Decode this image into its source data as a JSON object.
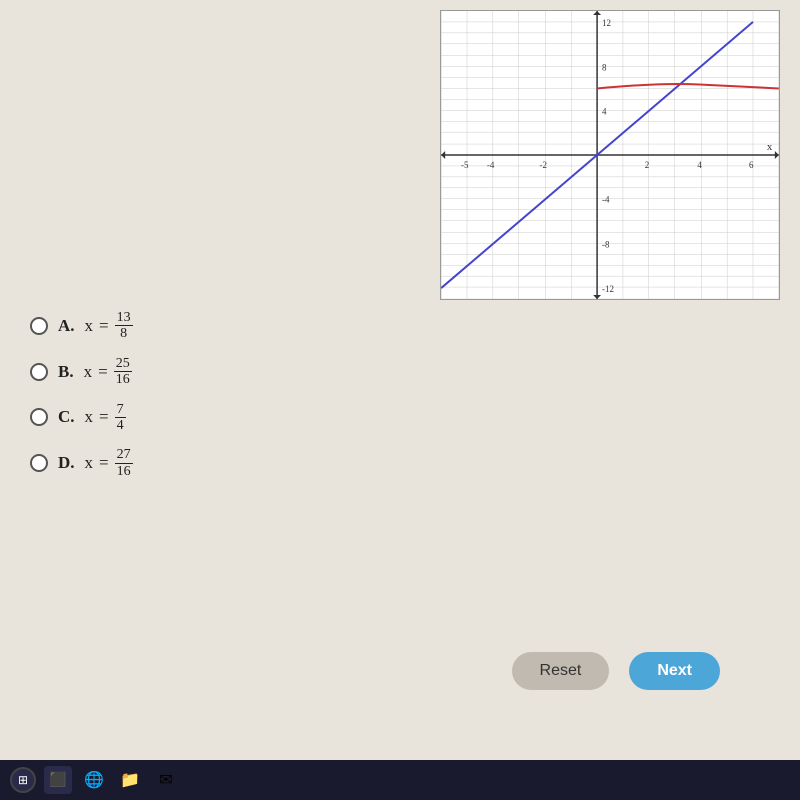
{
  "graph": {
    "xMin": -6,
    "xMax": 7,
    "yMin": -13,
    "yMax": 13,
    "xAxisLabel": "x"
  },
  "answers": [
    {
      "id": "A",
      "label": "A.",
      "variable": "x",
      "equals": "=",
      "numerator": "13",
      "denominator": "8"
    },
    {
      "id": "B",
      "label": "B.",
      "variable": "x",
      "equals": "=",
      "numerator": "25",
      "denominator": "16"
    },
    {
      "id": "C",
      "label": "C.",
      "variable": "x",
      "equals": "=",
      "numerator": "7",
      "denominator": "4"
    },
    {
      "id": "D",
      "label": "D.",
      "variable": "x",
      "equals": "=",
      "numerator": "27",
      "denominator": "16"
    }
  ],
  "buttons": {
    "reset": "Reset",
    "next": "Next"
  },
  "taskbar": {
    "items": [
      "⊞",
      "⬛",
      "🌐",
      "📁",
      "✉"
    ]
  }
}
